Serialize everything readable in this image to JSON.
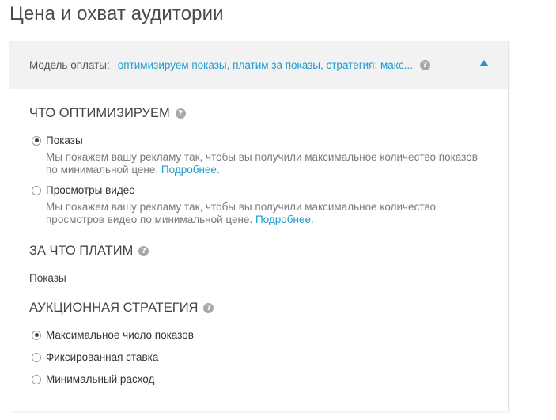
{
  "page": {
    "title": "Цена и охват аудитории"
  },
  "header": {
    "model_label": "Модель оплаты:",
    "model_value": "оптимизируем показы, платим за показы, стратегия: макс...",
    "help_glyph": "?"
  },
  "optimize": {
    "title": "ЧТО ОПТИМИЗИРУЕМ",
    "options": [
      {
        "label": "Показы",
        "checked": true,
        "desc": "Мы покажем вашу рекламу так, чтобы вы получили максимальное количество показов по минимальной цене.",
        "link": "Подробнее"
      },
      {
        "label": "Просмотры видео",
        "checked": false,
        "desc": "Мы покажем вашу рекламу так, чтобы вы получили максимальное количество просмотров видео по минимальной цене.",
        "link": "Подробнее"
      }
    ]
  },
  "pay": {
    "title": "ЗА ЧТО ПЛАТИМ",
    "value": "Показы"
  },
  "strategy": {
    "title": "АУКЦИОННАЯ СТРАТЕГИЯ",
    "options": [
      {
        "label": "Максимальное число показов",
        "checked": true
      },
      {
        "label": "Фиксированная ставка",
        "checked": false
      },
      {
        "label": "Минимальный расход",
        "checked": false
      }
    ]
  },
  "colors": {
    "accent": "#1e9bd0",
    "header_bg": "#f2f2f2",
    "help_icon": "#a8a8a8"
  }
}
